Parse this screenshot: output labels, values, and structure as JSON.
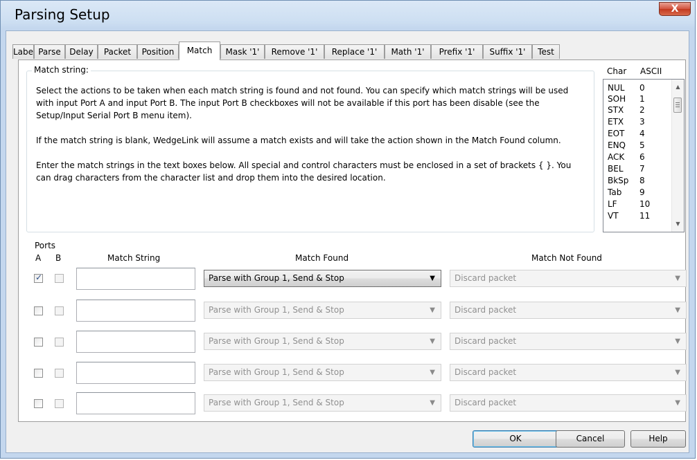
{
  "window": {
    "title": "Parsing Setup",
    "close_label": "X"
  },
  "tabs": [
    {
      "label": "Label"
    },
    {
      "label": "Parse"
    },
    {
      "label": "Delay"
    },
    {
      "label": "Packet"
    },
    {
      "label": "Position"
    },
    {
      "label": "Match",
      "active": true
    },
    {
      "label": "Mask '1'"
    },
    {
      "label": "Remove '1'"
    },
    {
      "label": "Replace '1'"
    },
    {
      "label": "Math '1'"
    },
    {
      "label": "Prefix '1'"
    },
    {
      "label": "Suffix '1'"
    },
    {
      "label": "Test"
    }
  ],
  "match_group": {
    "label": "Match string:",
    "paragraphs": [
      "Select the actions to be taken when each match string is found and not found.  You can specify which match strings will be used with input Port A and input Port B.  The input Port B checkboxes will not be available if this port has been disable (see the Setup/Input Serial Port B menu item).",
      "If the match string is blank, WedgeLink will assume a match exists and will take the action shown in the Match Found column.",
      "Enter the match strings in the text boxes below.  All special and control characters must be enclosed in a set of brackets { }.  You can drag characters from the character list and drop them into the desired location."
    ]
  },
  "char_list": {
    "header_char": "Char",
    "header_ascii": "ASCII",
    "items": [
      {
        "char": "NUL",
        "ascii": "0"
      },
      {
        "char": "SOH",
        "ascii": "1"
      },
      {
        "char": "STX",
        "ascii": "2"
      },
      {
        "char": "ETX",
        "ascii": "3"
      },
      {
        "char": "EOT",
        "ascii": "4"
      },
      {
        "char": "ENQ",
        "ascii": "5"
      },
      {
        "char": "ACK",
        "ascii": "6"
      },
      {
        "char": "BEL",
        "ascii": "7"
      },
      {
        "char": "BkSp",
        "ascii": "8"
      },
      {
        "char": "Tab",
        "ascii": "9"
      },
      {
        "char": "LF",
        "ascii": "10"
      },
      {
        "char": "VT",
        "ascii": "11"
      }
    ]
  },
  "columns": {
    "ports": "Ports",
    "port_a": "A",
    "port_b": "B",
    "match_string": "Match String",
    "match_found": "Match Found",
    "match_not_found": "Match Not Found"
  },
  "rows": [
    {
      "port_a": true,
      "port_b": false,
      "match_string": "",
      "found": "Parse with Group 1, Send & Stop",
      "not_found": "Discard packet",
      "found_enabled": true
    },
    {
      "port_a": false,
      "port_b": false,
      "match_string": "",
      "found": "Parse with Group 1, Send & Stop",
      "not_found": "Discard packet",
      "found_enabled": false
    },
    {
      "port_a": false,
      "port_b": false,
      "match_string": "",
      "found": "Parse with Group 1, Send & Stop",
      "not_found": "Discard packet",
      "found_enabled": false
    },
    {
      "port_a": false,
      "port_b": false,
      "match_string": "",
      "found": "Parse with Group 1, Send & Stop",
      "not_found": "Discard packet",
      "found_enabled": false
    },
    {
      "port_a": false,
      "port_b": false,
      "match_string": "",
      "found": "Parse with Group 1, Send & Stop",
      "not_found": "Discard packet",
      "found_enabled": false
    }
  ],
  "buttons": {
    "ok": "OK",
    "cancel": "Cancel",
    "help": "Help"
  }
}
